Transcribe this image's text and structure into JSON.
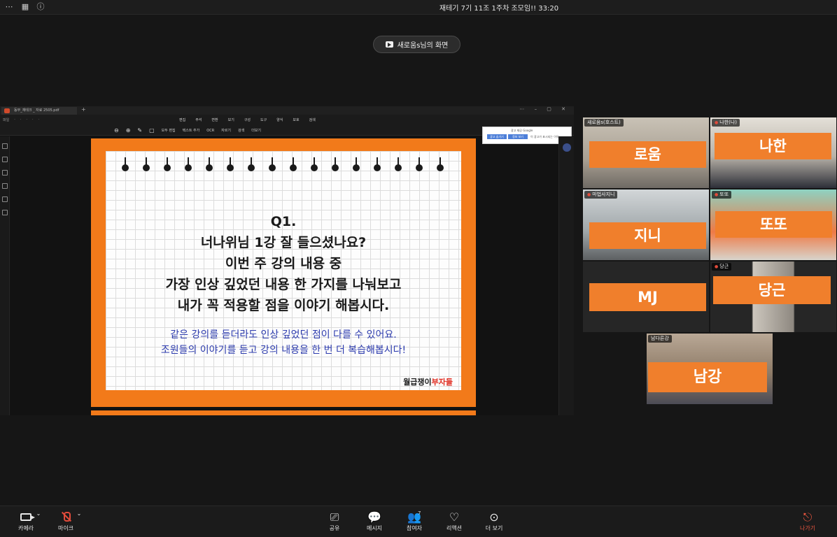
{
  "topbar": {
    "title": "재테기 7기 11조 1주차 조모임!! 33:20",
    "icons": [
      "more-icon",
      "grid-icon",
      "info-icon"
    ]
  },
  "share_banner": {
    "label": "새로움s님의 화면"
  },
  "pdf": {
    "tab_title": "동부_재테크 _ 자료 2505.pdf",
    "left_menu": [
      "파일",
      "·",
      "·",
      "·",
      "·",
      "·"
    ],
    "menu": [
      "편집",
      "주석",
      "변환",
      "보기",
      "구성",
      "도구",
      "양식",
      "보호",
      "검색"
    ],
    "tools": [
      "모두 편집",
      "텍스트 추가",
      "OCR",
      "자르기",
      "검색",
      "더보기"
    ],
    "ad": {
      "title": "광고 제공 Google",
      "btn1": "광고 숨기기",
      "btn2": "정보 보기",
      "note": "이 광고가 표시되는 이유"
    }
  },
  "slide": {
    "lines": [
      "Q1.",
      "너나위님 1강 잘 들으셨나요?",
      "이번 주 강의 내용 중",
      "가장 인상 깊었던 내용 한 가지를 나눠보고",
      "내가 꼭 적용할 점을 이야기 해봅시다."
    ],
    "sub_lines": [
      "같은 강의를 듣더라도 인상 깊었던 점이 다를 수 있어요.",
      "조원들의 이야기를 듣고 강의 내용을 한 번 더 복습해봅시다!"
    ],
    "brand_black": "월급쟁이",
    "brand_red": "부자들"
  },
  "participants": [
    {
      "tag": "새로움s(호스트)",
      "big": "로움",
      "muted": false
    },
    {
      "tag": "나한(나)",
      "big": "나한",
      "muted": true
    },
    {
      "tag": "마법사지니",
      "big": "지니",
      "muted": true
    },
    {
      "tag": "또또",
      "big": "또또",
      "muted": true
    },
    {
      "tag": "",
      "big": "MJ",
      "muted": false
    },
    {
      "tag": "당근",
      "big": "당근",
      "muted": true
    },
    {
      "tag": "남다른강",
      "big": "남강",
      "muted": false
    }
  ],
  "toolbar": {
    "camera": "카메라",
    "mic": "마이크",
    "share": "공유",
    "chat": "메시지",
    "participants": "참여자",
    "participants_count": "7",
    "reactions": "리액션",
    "more": "더 보기",
    "leave": "나가기"
  },
  "colors": {
    "accent_orange": "#f07f2c",
    "leave_red": "#e8563f",
    "speaker_green": "#3ec66b",
    "host_cyan": "#28b5c8"
  }
}
